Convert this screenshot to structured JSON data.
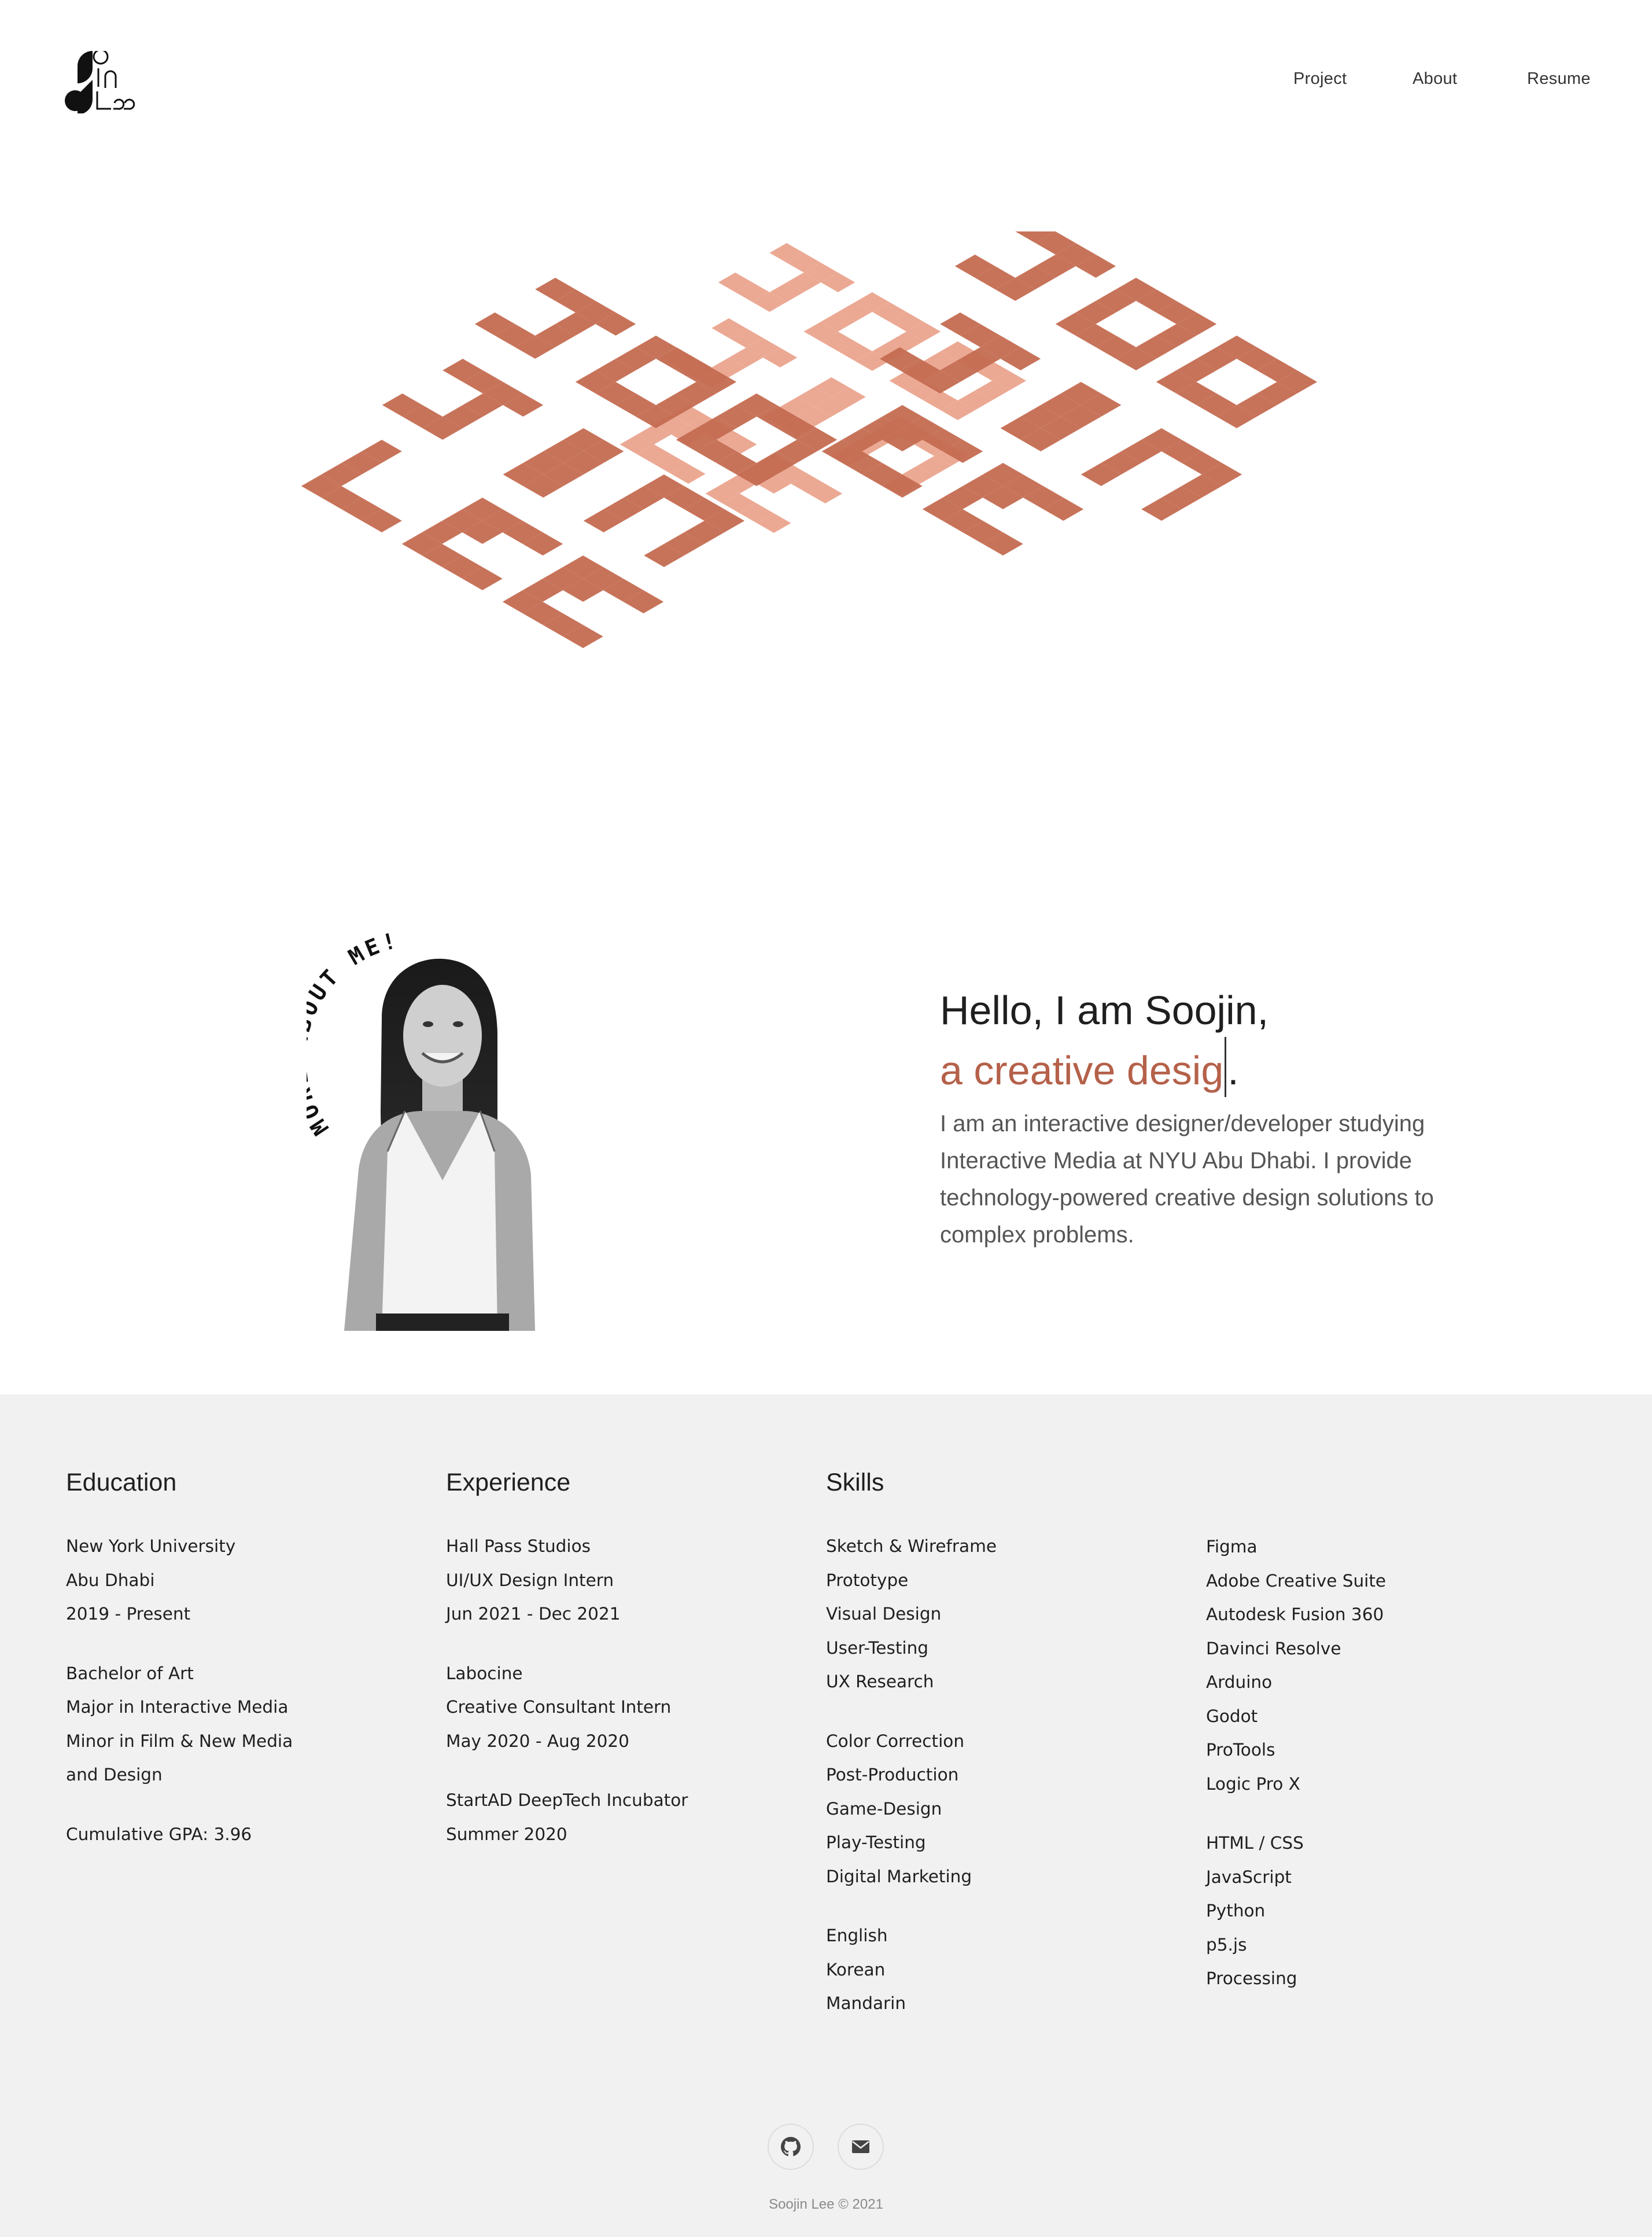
{
  "colors": {
    "accent": "#b5614a",
    "pattern_dark": "#c46b51",
    "pattern_light": "#eaa48e",
    "panel_bg": "#f1f1f1"
  },
  "header": {
    "logo_icon": "soojin-lee-logo",
    "logo_text": "Soojin Lee",
    "nav": [
      "Project",
      "About",
      "Resume"
    ]
  },
  "hero": {
    "art_icon": "isometric-name-pattern"
  },
  "about": {
    "portrait_icon": "portrait-photo",
    "curved_text": "MORE ABOUT ME!",
    "greeting": "Hello, I am Soojin,",
    "role_typed": "a creative desig",
    "role_end": ".",
    "bio": "I am an interactive designer/developer studying Interactive Media at NYU Abu Dhabi. I provide technology-powered creative design solutions to complex problems."
  },
  "education": {
    "title": "Education",
    "groups": [
      [
        "New York University",
        "Abu Dhabi",
        "2019 - Present"
      ],
      [
        "Bachelor of Art",
        "Major in Interactive Media",
        "Minor in Film & New Media",
        "and Design"
      ],
      [
        "Cumulative GPA: 3.96"
      ]
    ]
  },
  "experience": {
    "title": "Experience",
    "groups": [
      [
        "Hall Pass Studios",
        "UI/UX Design Intern",
        "Jun 2021 - Dec 2021"
      ],
      [
        "Labocine",
        "Creative Consultant Intern",
        "May 2020 - Aug 2020"
      ],
      [
        "StartAD DeepTech Incubator",
        "Summer 2020"
      ]
    ]
  },
  "skills": {
    "title": "Skills",
    "col1": [
      [
        "Sketch & Wireframe",
        "Prototype",
        "Visual Design",
        "User-Testing",
        "UX Research"
      ],
      [
        "Color Correction",
        "Post-Production",
        "Game-Design",
        "Play-Testing",
        "Digital Marketing"
      ],
      [
        "English",
        "Korean",
        "Mandarin"
      ]
    ],
    "col2": [
      [
        "Figma",
        "Adobe Creative Suite",
        "Autodesk Fusion 360",
        "Davinci Resolve",
        "Arduino",
        "Godot",
        "ProTools",
        "Logic Pro X"
      ],
      [
        "HTML / CSS",
        "JavaScript",
        "Python",
        "p5.js",
        "Processing"
      ]
    ]
  },
  "footer": {
    "github_icon": "github-icon",
    "mail_icon": "mail-icon",
    "copyright": "Soojin Lee © 2021"
  }
}
